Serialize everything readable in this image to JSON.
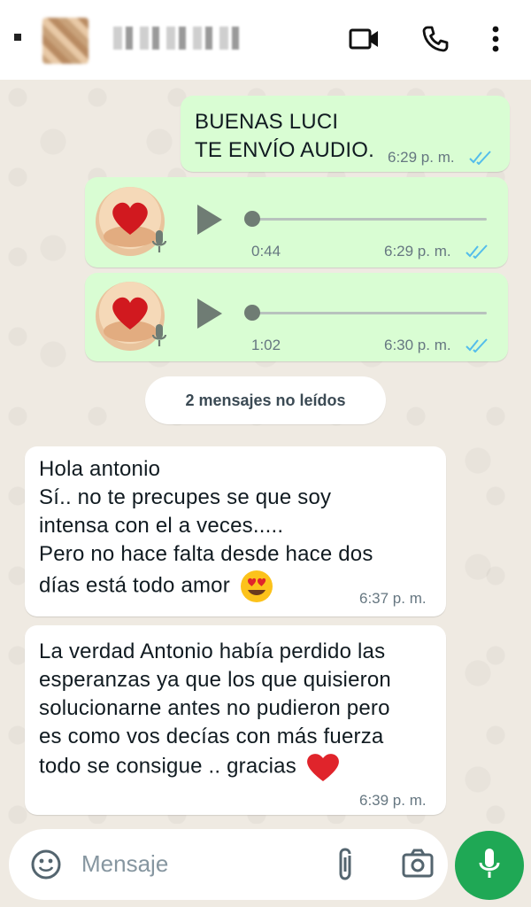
{
  "header": {
    "contact_name": "",
    "icons": [
      "back-icon",
      "avatar",
      "video-call-icon",
      "phone-icon",
      "more-vert-icon"
    ]
  },
  "messages": [
    {
      "type": "text",
      "direction": "out",
      "text": "BUENAS LUCI\nTE ENVÍO AUDIO.",
      "time": "6:29 p. m.",
      "status": "read"
    },
    {
      "type": "voice",
      "direction": "out",
      "duration": "0:44",
      "time": "6:29 p. m.",
      "status": "read"
    },
    {
      "type": "voice",
      "direction": "out",
      "duration": "1:02",
      "time": "6:30 p. m.",
      "status": "read"
    },
    {
      "type": "text",
      "direction": "in",
      "text": "Hola antonio\nSí.. no te precupes se que soy\nintensa con el a veces.....\nPero no hace falta desde hace dos\ndías está todo amor",
      "emoji": "smiling-face-with-heart-eyes",
      "time": "6:37 p. m."
    },
    {
      "type": "text",
      "direction": "in",
      "text": "La verdad Antonio había perdido las\nesperanzas ya que los que quisieron\nsolucionarne antes no pudieron  pero\nes como vos decías con más fuerza\ntodo se consigue .. gracias",
      "emoji": "red-heart",
      "time": "6:39 p. m."
    }
  ],
  "unread_divider": "2 mensajes no leídos",
  "input": {
    "placeholder": "Mensaje"
  },
  "colors": {
    "outgoing_bubble": "#d9fdd3",
    "incoming_bubble": "#ffffff",
    "chat_background": "#efeae2",
    "read_ticks": "#53bdeb",
    "mic_button": "#1fa855"
  }
}
